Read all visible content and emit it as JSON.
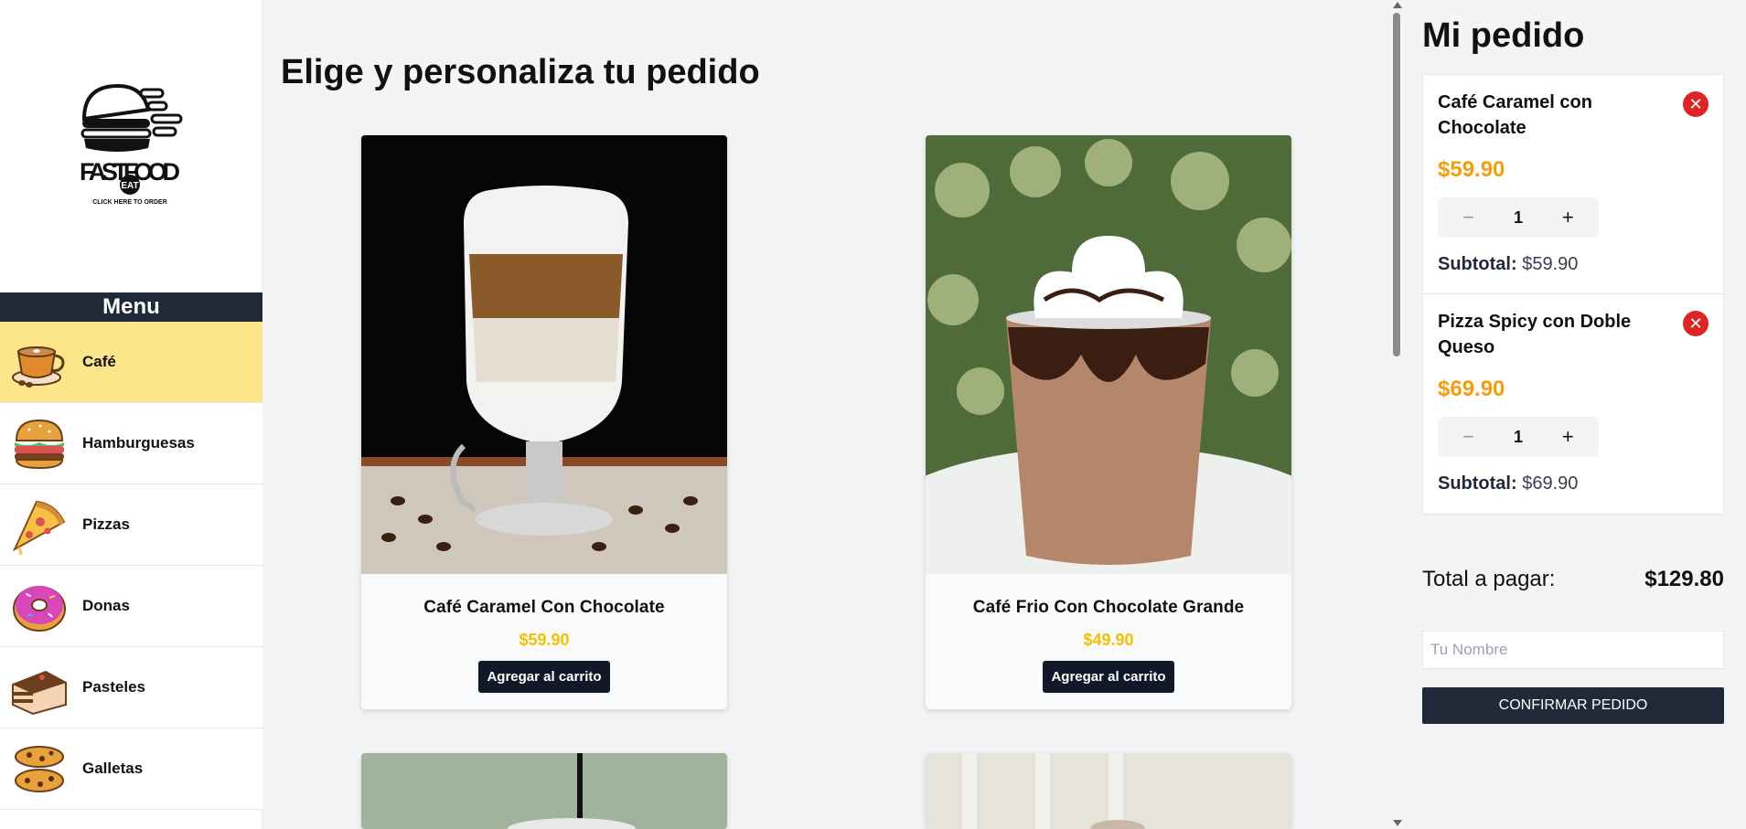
{
  "sidebar": {
    "logo": {
      "line1": "FASTFOOD",
      "badge": "EAT",
      "tagline": "CLICK HERE TO ORDER"
    },
    "menu_title": "Menu",
    "categories": [
      {
        "label": "Café",
        "icon": "coffee-cup-icon",
        "active": true
      },
      {
        "label": "Hamburguesas",
        "icon": "burger-icon",
        "active": false
      },
      {
        "label": "Pizzas",
        "icon": "pizza-slice-icon",
        "active": false
      },
      {
        "label": "Donas",
        "icon": "donut-icon",
        "active": false
      },
      {
        "label": "Pasteles",
        "icon": "cake-slice-icon",
        "active": false
      },
      {
        "label": "Galletas",
        "icon": "cookies-icon",
        "active": false
      }
    ]
  },
  "main": {
    "title": "Elige y personaliza tu pedido",
    "products": [
      {
        "name": "Café Caramel Con Chocolate",
        "price": "$59.90",
        "button": "Agregar al carrito"
      },
      {
        "name": "Café Frio Con Chocolate Grande",
        "price": "$49.90",
        "button": "Agregar al carrito"
      }
    ]
  },
  "order": {
    "title": "Mi pedido",
    "items": [
      {
        "name": "Café Caramel con Chocolate",
        "price": "$59.90",
        "qty": "1",
        "subtotal_label": "Subtotal:",
        "subtotal": "$59.90"
      },
      {
        "name": "Pizza Spicy con Doble Queso",
        "price": "$69.90",
        "qty": "1",
        "subtotal_label": "Subtotal:",
        "subtotal": "$69.90"
      }
    ],
    "total_label": "Total a pagar:",
    "total_value": "$129.80",
    "name_placeholder": "Tu Nombre",
    "confirm_label": "CONFIRMAR PEDIDO"
  },
  "colors": {
    "accent_yellow": "#fde68a",
    "price_yellow": "#f5c000",
    "order_price": "#f59e0b",
    "dark": "#1f2937",
    "remove_red": "#dc2626"
  }
}
